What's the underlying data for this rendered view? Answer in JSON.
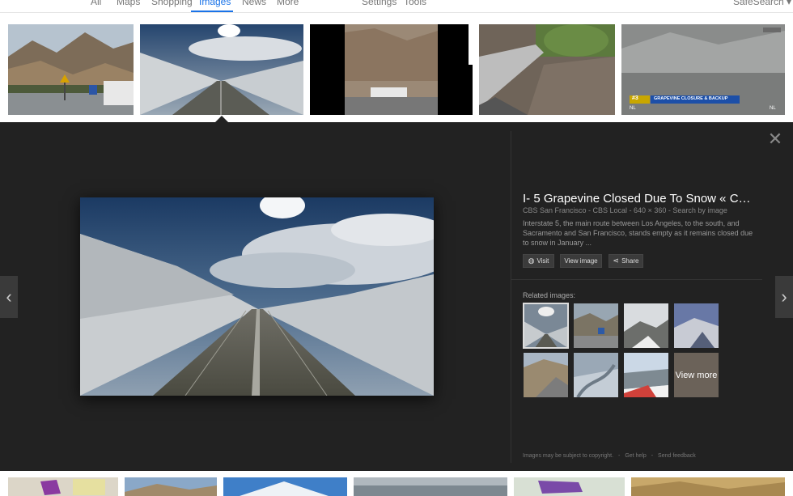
{
  "nav": {
    "items": [
      "All",
      "Maps",
      "Shopping",
      "Images",
      "News",
      "More"
    ],
    "settings": "Settings",
    "tools": "Tools",
    "safesearch": "SafeSearch ▾"
  },
  "thumb_overlay": {
    "badge": "#3",
    "banner": "GRAPEVINE CLOSURE & BACKUP",
    "corner": "NL",
    "corner2": "NL"
  },
  "detail": {
    "title": "I- 5 Grapevine Closed Due To Snow « C…",
    "meta": "CBS San Francisco - CBS Local - 640 × 360 - Search by image",
    "description": "Interstate 5, the main route between Los Angeles, to the south, and Sacramento and San Francisco, stands empty as it remains closed due to snow in January ...",
    "buttons": {
      "visit": "Visit",
      "view_image": "View image",
      "share": "Share"
    },
    "related_label": "Related images:",
    "view_more": "View more",
    "footer": {
      "copyright": "Images may be subject to copyright.",
      "help": "Get help",
      "feedback": "Send feedback",
      "sep": "-"
    }
  },
  "colors": {
    "panel_bg": "#222222",
    "accent": "#1a73e8"
  }
}
